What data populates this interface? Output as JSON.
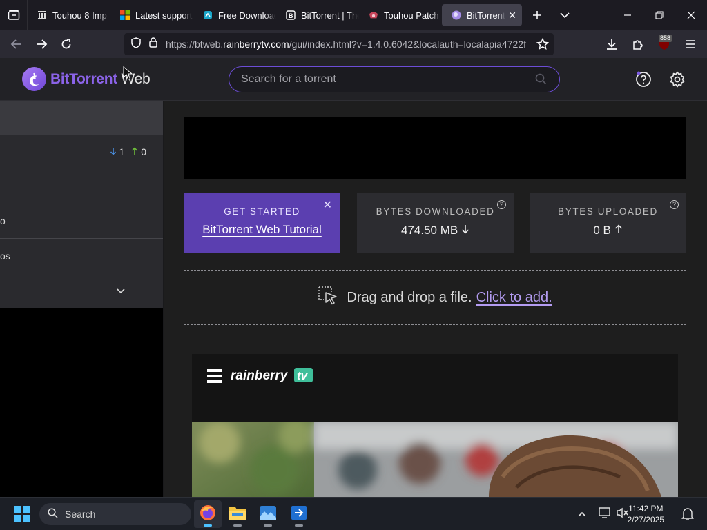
{
  "browser": {
    "tabs": [
      {
        "title": "Touhou 8 Imp",
        "icon": "wiki-icon"
      },
      {
        "title": "Latest support",
        "icon": "microsoft-icon"
      },
      {
        "title": "Free Download",
        "icon": "softonic-icon"
      },
      {
        "title": "BitTorrent | The",
        "icon": "bittorrent-b-icon"
      },
      {
        "title": "Touhou Patch C",
        "icon": "touhou-icon"
      },
      {
        "title": "BitTorrent W",
        "icon": "bittorrent-web-icon",
        "active": true
      }
    ],
    "url_prefix": "https://btweb.",
    "url_domain": "rainberrytv.com",
    "url_rest": "/gui/index.html?v=1.4.0.6042&localauth=localapia4722f",
    "extension_badge": "858"
  },
  "app": {
    "logo_brand": "BitTorrent",
    "logo_suffix": " Web",
    "search_placeholder": "Search for a torrent",
    "colors": {
      "accent": "#6c4dd6",
      "card_purple": "#5b3fb0"
    }
  },
  "sidebar": {
    "down_count": "1",
    "up_count": "0",
    "row1_text": "o",
    "row2_text": "os"
  },
  "main": {
    "get_started_label": "GET STARTED",
    "tutorial_link": "BitTorrent Web Tutorial",
    "bytes_downloaded_label": "BYTES DOWNLOADED",
    "bytes_downloaded_value": "474.50 MB",
    "bytes_uploaded_label": "BYTES UPLOADED",
    "bytes_uploaded_value": "0 B",
    "drop_text": "Drag and drop a file.",
    "drop_link": "Click to add."
  },
  "taskbar": {
    "search_label": "Search",
    "time": "11:42 PM",
    "date": "2/27/2025"
  }
}
